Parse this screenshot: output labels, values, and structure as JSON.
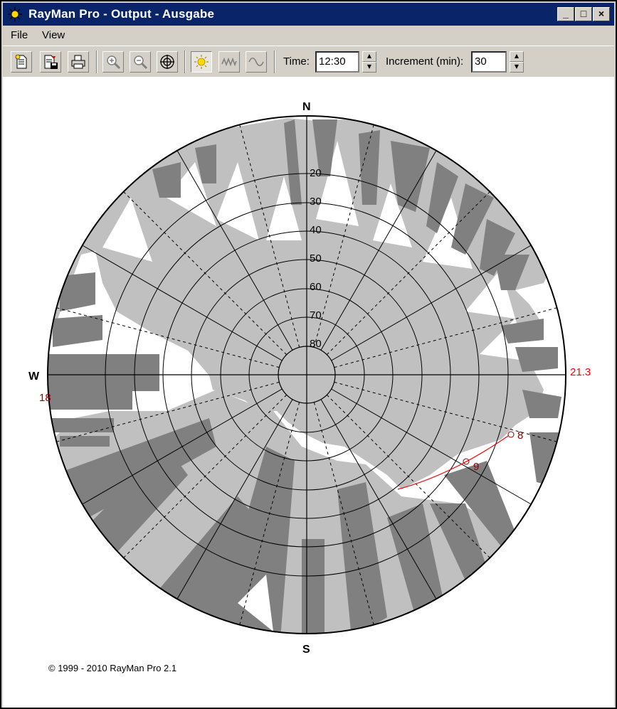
{
  "window": {
    "title": "RayMan Pro - Output - Ausgabe",
    "controls": {
      "minimize": "_",
      "maximize": "□",
      "close": "×"
    }
  },
  "menu": {
    "file": "File",
    "view": "View"
  },
  "toolbar": {
    "time_label": "Time:",
    "time_value": "12:30",
    "increment_label": "Increment (min):",
    "increment_value": "30",
    "buttons": [
      "new-document",
      "save",
      "print",
      "zoom-in",
      "zoom-out",
      "polar-grid",
      "sun-path",
      "wave",
      "sine"
    ]
  },
  "diagram": {
    "compass": {
      "north": "N",
      "south": "S",
      "west": "W"
    },
    "elevation_labels": [
      "20",
      "30",
      "40",
      "50",
      "60",
      "70",
      "80"
    ],
    "sun_path_labels": {
      "left_edge": "18",
      "right_edge": "21.3",
      "hour_a": "9",
      "hour_b": "8"
    },
    "colors": {
      "sky": "#ffffff",
      "obstacle_light": "#c0c0c0",
      "obstacle_dark": "#808080",
      "sun_path": "#ff0000",
      "sun_label": "#8b0000"
    }
  },
  "footer": {
    "copyright": "© 1999 - 2010 RayMan Pro 2.1"
  }
}
